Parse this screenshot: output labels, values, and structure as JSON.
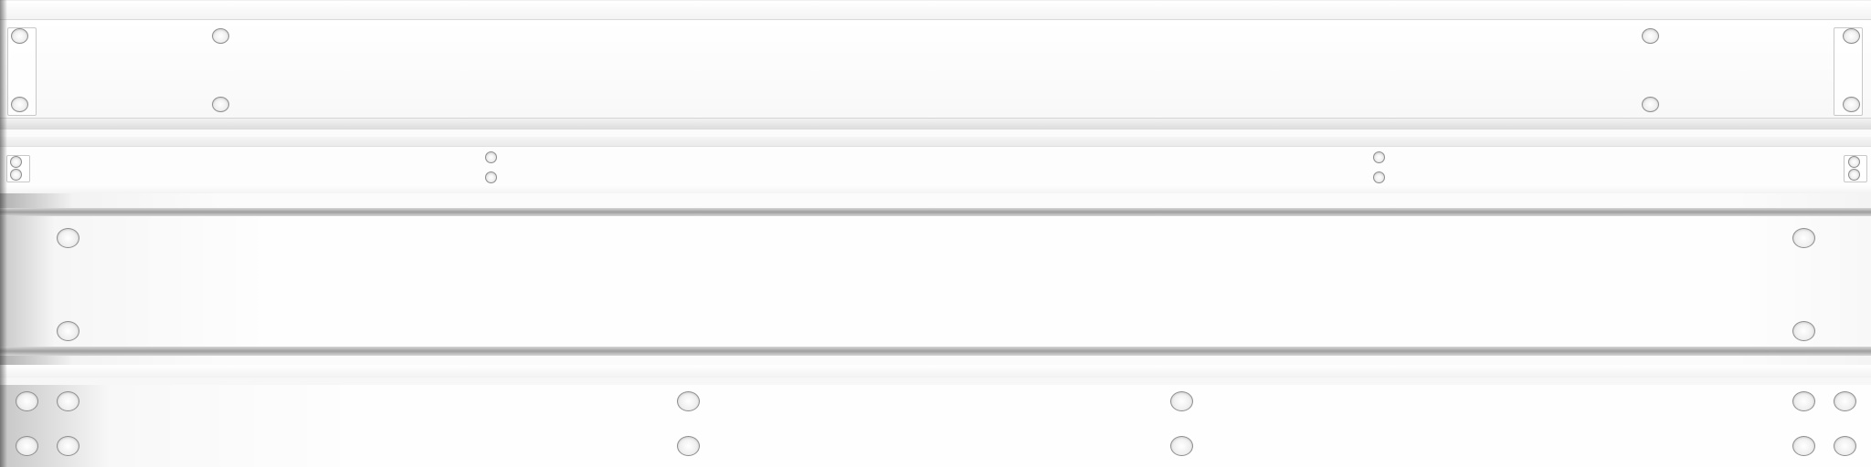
{
  "scene": {
    "description_label": "",
    "colors": {
      "background": "#fbfbfb",
      "rail_shadow": "#9f9f9f",
      "hole_rim": "#8e8e8e",
      "bracket_border": "#c8c8c8"
    },
    "panels": [
      {
        "id": "panel-a",
        "hole_count": 8
      },
      {
        "id": "panel-b",
        "hole_count": 8
      },
      {
        "id": "panel-c",
        "hole_count": 4
      },
      {
        "id": "panel-d",
        "hole_count": 12
      }
    ]
  }
}
